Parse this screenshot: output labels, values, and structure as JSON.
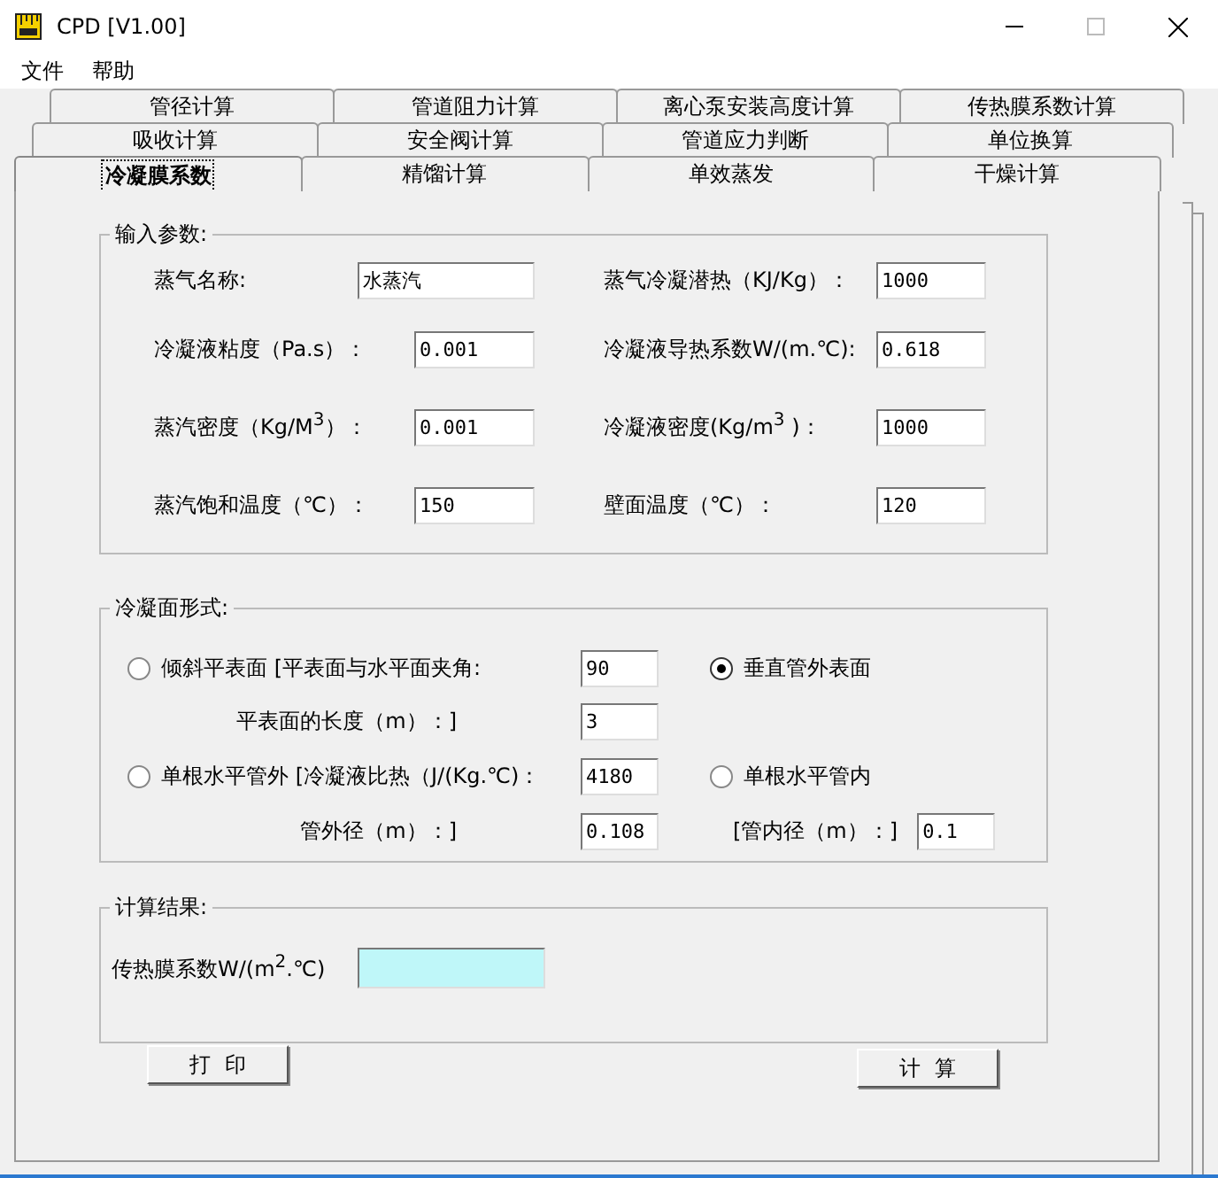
{
  "window": {
    "title": "CPD [V1.00]"
  },
  "menu": [
    "文件",
    "帮助"
  ],
  "tab_rows": [
    [
      {
        "label": "管径计算",
        "selected": false
      },
      {
        "label": "管道阻力计算",
        "selected": false
      },
      {
        "label": "离心泵安装高度计算",
        "selected": false
      },
      {
        "label": "传热膜系数计算",
        "selected": false
      }
    ],
    [
      {
        "label": "吸收计算",
        "selected": false
      },
      {
        "label": "安全阀计算",
        "selected": false
      },
      {
        "label": "管道应力判断",
        "selected": false
      },
      {
        "label": "单位换算",
        "selected": false
      }
    ],
    [
      {
        "label": "冷凝膜系数",
        "selected": true
      },
      {
        "label": "精馏计算",
        "selected": false
      },
      {
        "label": "单效蒸发",
        "selected": false
      },
      {
        "label": "干燥计算",
        "selected": false
      }
    ]
  ],
  "input_group": {
    "title": "输入参数:",
    "rows": [
      {
        "left": {
          "label": "蒸气名称:",
          "value": "水蒸汽"
        },
        "right": {
          "label": "蒸气冷凝潜热（KJ/Kg）：",
          "value": "1000"
        }
      },
      {
        "left": {
          "label": "冷凝液粘度（Pa.s）：",
          "value": "0.001"
        },
        "right": {
          "label": "冷凝液导热系数W/(m.℃):",
          "value": "0.618"
        }
      },
      {
        "left": {
          "label": "蒸汽密度（Kg/M$^{3}$）：",
          "value": "0.001"
        },
        "right": {
          "label": "冷凝液密度(Kg/m$^{3}$ )：",
          "value": "1000"
        }
      },
      {
        "left": {
          "label": "蒸汽饱和温度（℃）：",
          "value": "150"
        },
        "right": {
          "label": "壁面温度（℃）：",
          "value": "120"
        }
      }
    ]
  },
  "surface_group": {
    "title": "冷凝面形式:",
    "options": [
      {
        "label": "倾斜平表面 [平表面与水平面夹角:",
        "value": "90",
        "selected": false,
        "sub_label": "平表面的长度（m）：]",
        "sub_value": "3"
      },
      {
        "label": "垂直管外表面",
        "selected": true
      },
      {
        "label": "单根水平管外 [冷凝液比热（J/(Kg.℃)：",
        "value": "4180",
        "selected": false,
        "sub_label": "管外径（m）：]",
        "sub_value": "0.108"
      },
      {
        "label": "单根水平管内",
        "selected": false,
        "sub_label": "[管内径（m）：]",
        "sub_value": "0.1"
      }
    ]
  },
  "result_group": {
    "title": "计算结果:",
    "label": "传热膜系数W/(m$^{2}$.℃)"
  },
  "buttons": [
    "打  印",
    "计  算"
  ]
}
